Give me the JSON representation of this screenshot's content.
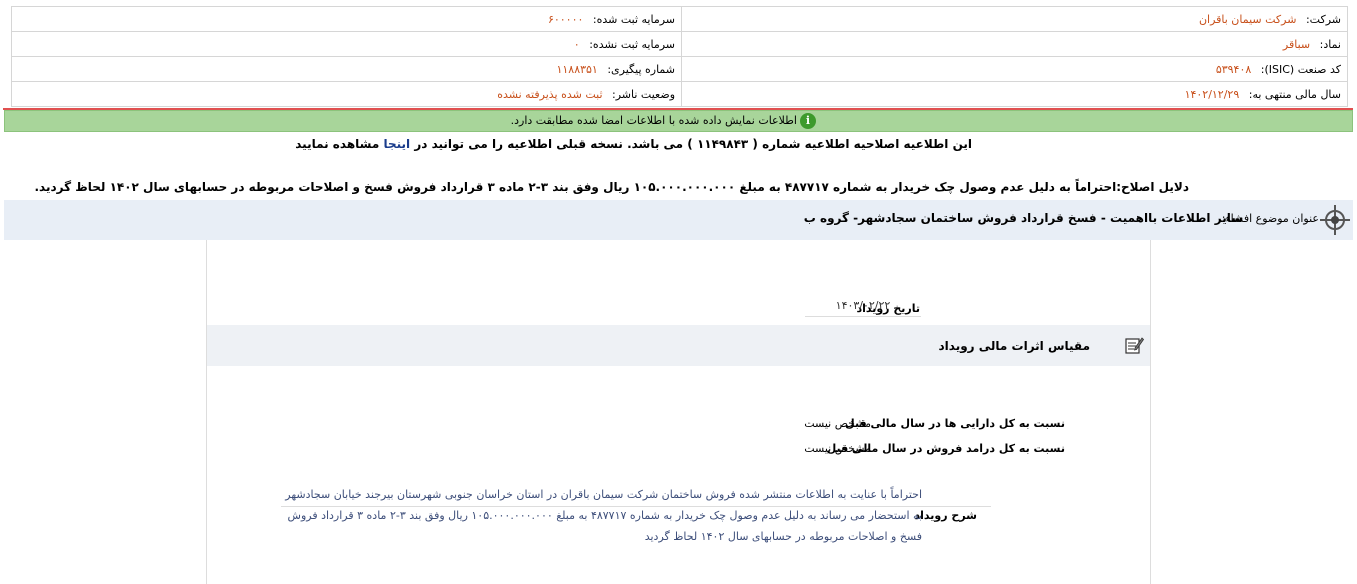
{
  "info": {
    "company_label": "شرکت:",
    "company_value": "شرکت سیمان باقران",
    "registered_capital_label": "سرمایه ثبت شده:",
    "registered_capital_value": "۶۰۰۰۰۰",
    "symbol_label": "نماد:",
    "symbol_value": "سباقر",
    "unregistered_capital_label": "سرمایه ثبت نشده:",
    "unregistered_capital_value": "۰",
    "isic_label": "کد صنعت (ISIC):",
    "isic_value": "۵۳۹۴۰۸",
    "tracking_label": "شماره پیگیری:",
    "tracking_value": "۱۱۸۸۳۵۱",
    "fiscal_year_label": "سال مالی منتهی به:",
    "fiscal_year_value": "۱۴۰۲/۱۲/۲۹",
    "publisher_status_label": "وضعیت ناشر:",
    "publisher_status_value": "ثبت شده پذیرفته نشده"
  },
  "notice": {
    "text": "اطلاعات نمایش داده شده با اطلاعات امضا شده مطابقت دارد.",
    "icon": "info-icon"
  },
  "correction": {
    "prefix": "این اطلاعیه اصلاحیه اطلاعیه شماره ( ۱۱۴۹۸۴۳ ) می باشد. نسخه قبلی اطلاعیه را می توانید در",
    "link": "اینجا",
    "suffix": "مشاهده نمایید"
  },
  "reasons": {
    "text": "دلایل اصلاح:احتراماً به دلیل عدم وصول چک خریدار به شماره ۴۸۷۷۱۷ به مبلغ ۱۰۵.۰۰۰.۰۰۰.۰۰۰ ریال وفق بند ۳-۲ ماده ۳ قرارداد فروش فسخ و اصلاحات مربوطه در حسابهای سال ۱۴۰۲ لحاظ گردید."
  },
  "subject": {
    "label": "عنوان موضوع افشاء:",
    "title": "سایر اطلاعات بااهمیت - فسخ قرارداد فروش ساختمان سجادشهر- گروه ب",
    "icon": "target-icon"
  },
  "event": {
    "date_label": "تاریخ رویداد",
    "date_value": "۱۴۰۳/۰۲/۲۲"
  },
  "financial": {
    "title": "مقیاس اثرات مالی رویداد",
    "icon": "edit-note-icon",
    "rows": [
      {
        "label": "نسبت به کل دارایی ها در سال مالی قبل",
        "value": "مشخص نیست"
      },
      {
        "label": "نسبت به کل درامد فروش در سال مالی قبل",
        "value": "مشخص نیست"
      }
    ]
  },
  "description": {
    "label": "شرح رویداد",
    "text": "احتراماً با عنایت به اطلاعات منتشر شده فروش ساختمان شرکت سیمان باقران در استان خراسان جنوبی شهرستان بیرجند خیابان سجادشهر به استحضار می رساند به دلیل عدم وصول چک خریدار به شماره ۴۸۷۷۱۷ به مبلغ ۱۰۵.۰۰۰.۰۰۰.۰۰۰ ریال وفق بند ۳-۲ ماده ۳ قرارداد فروش فسخ و اصلاحات مربوطه در حسابهای سال ۱۴۰۲ لحاظ گردید"
  },
  "colors": {
    "value_text": "#c8501b",
    "notice_bg": "#a8d59a",
    "subject_bg": "#e8eef6",
    "link": "#1a3c8c",
    "alert_rule": "#e05050"
  }
}
